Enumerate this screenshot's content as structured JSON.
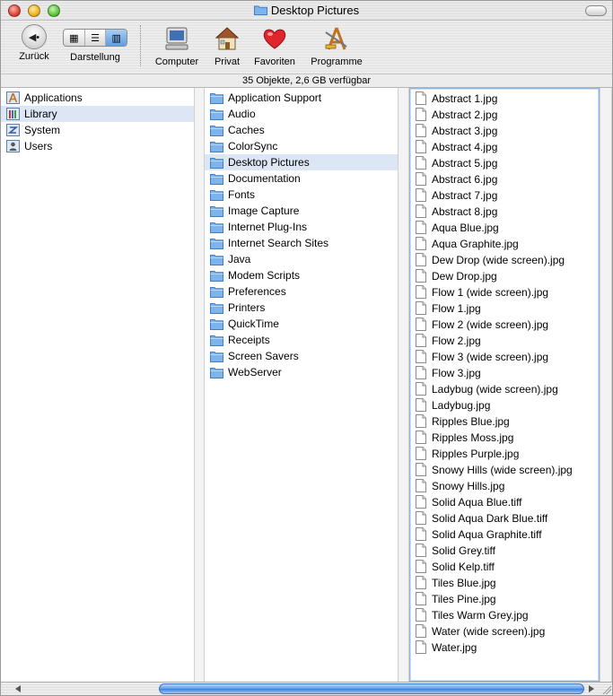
{
  "window": {
    "title": "Desktop Pictures"
  },
  "toolbar": {
    "back_label": "Zurück",
    "view_label": "Darstellung",
    "computer_label": "Computer",
    "home_label": "Privat",
    "favorites_label": "Favoriten",
    "applications_label": "Programme"
  },
  "status": {
    "text": "35 Objekte, 2,6 GB verfügbar"
  },
  "colors": {
    "selection": "#dce6f4",
    "folder": "#7fb4ea",
    "accent": "#3a7fd9"
  },
  "columns": {
    "col1": [
      {
        "label": "Applications",
        "icon": "applications-folder-icon",
        "selected": false
      },
      {
        "label": "Library",
        "icon": "library-folder-icon",
        "selected": true
      },
      {
        "label": "System",
        "icon": "system-folder-icon",
        "selected": false
      },
      {
        "label": "Users",
        "icon": "users-folder-icon",
        "selected": false
      }
    ],
    "col2": [
      {
        "label": "Application Support",
        "selected": false
      },
      {
        "label": "Audio",
        "selected": false
      },
      {
        "label": "Caches",
        "selected": false
      },
      {
        "label": "ColorSync",
        "selected": false
      },
      {
        "label": "Desktop Pictures",
        "selected": true
      },
      {
        "label": "Documentation",
        "selected": false
      },
      {
        "label": "Fonts",
        "selected": false
      },
      {
        "label": "Image Capture",
        "selected": false
      },
      {
        "label": "Internet Plug-Ins",
        "selected": false
      },
      {
        "label": "Internet Search Sites",
        "selected": false
      },
      {
        "label": "Java",
        "selected": false
      },
      {
        "label": "Modem Scripts",
        "selected": false
      },
      {
        "label": "Preferences",
        "selected": false
      },
      {
        "label": "Printers",
        "selected": false
      },
      {
        "label": "QuickTime",
        "selected": false
      },
      {
        "label": "Receipts",
        "selected": false
      },
      {
        "label": "Screen Savers",
        "selected": false
      },
      {
        "label": "WebServer",
        "selected": false
      }
    ],
    "col3": [
      "Abstract 1.jpg",
      "Abstract 2.jpg",
      "Abstract 3.jpg",
      "Abstract 4.jpg",
      "Abstract 5.jpg",
      "Abstract 6.jpg",
      "Abstract 7.jpg",
      "Abstract 8.jpg",
      "Aqua Blue.jpg",
      "Aqua Graphite.jpg",
      "Dew Drop (wide screen).jpg",
      "Dew Drop.jpg",
      "Flow 1 (wide screen).jpg",
      "Flow 1.jpg",
      "Flow 2 (wide screen).jpg",
      "Flow 2.jpg",
      "Flow 3 (wide screen).jpg",
      "Flow 3.jpg",
      "Ladybug (wide screen).jpg",
      "Ladybug.jpg",
      "Ripples Blue.jpg",
      "Ripples Moss.jpg",
      "Ripples Purple.jpg",
      "Snowy Hills (wide screen).jpg",
      "Snowy Hills.jpg",
      "Solid Aqua Blue.tiff",
      "Solid Aqua Dark Blue.tiff",
      "Solid Aqua Graphite.tiff",
      "Solid Grey.tiff",
      "Solid Kelp.tiff",
      "Tiles Blue.jpg",
      "Tiles Pine.jpg",
      "Tiles Warm Grey.jpg",
      "Water (wide screen).jpg",
      "Water.jpg"
    ]
  }
}
